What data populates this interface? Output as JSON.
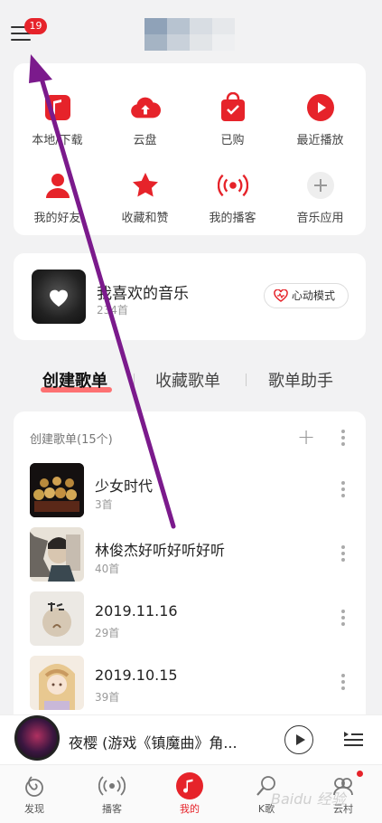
{
  "header": {
    "badge_count": "19"
  },
  "grid": [
    {
      "label": "本地/下载",
      "icon": "music-note-icon"
    },
    {
      "label": "云盘",
      "icon": "cloud-upload-icon"
    },
    {
      "label": "已购",
      "icon": "shopping-bag-icon"
    },
    {
      "label": "最近播放",
      "icon": "play-circle-icon"
    },
    {
      "label": "我的好友",
      "icon": "friends-icon"
    },
    {
      "label": "收藏和赞",
      "icon": "star-icon"
    },
    {
      "label": "我的播客",
      "icon": "radio-signal-icon"
    },
    {
      "label": "音乐应用",
      "icon": "plus-icon"
    }
  ],
  "favorites": {
    "title": "我喜欢的音乐",
    "count": "234首",
    "mode_button": "心动模式"
  },
  "tabs": {
    "created": "创建歌单",
    "collected": "收藏歌单",
    "assistant": "歌单助手"
  },
  "playlists": {
    "header": "创建歌单(15个)",
    "items": [
      {
        "name": "少女时代",
        "count": "3首"
      },
      {
        "name": "林俊杰好听好听好听",
        "count": "40首"
      },
      {
        "name": "2019.11.16",
        "count": "29首"
      },
      {
        "name": "2019.10.15",
        "count": "39首"
      }
    ]
  },
  "player": {
    "title": "夜樱 (游戏《镇魔曲》角..."
  },
  "bottom_nav": [
    {
      "label": "发现"
    },
    {
      "label": "播客"
    },
    {
      "label": "我的"
    },
    {
      "label": "K歌"
    },
    {
      "label": "云村"
    }
  ],
  "watermark": "Baidu 经验",
  "colors": {
    "accent": "#e6232a",
    "annotation_arrow": "#7b1a8c"
  }
}
